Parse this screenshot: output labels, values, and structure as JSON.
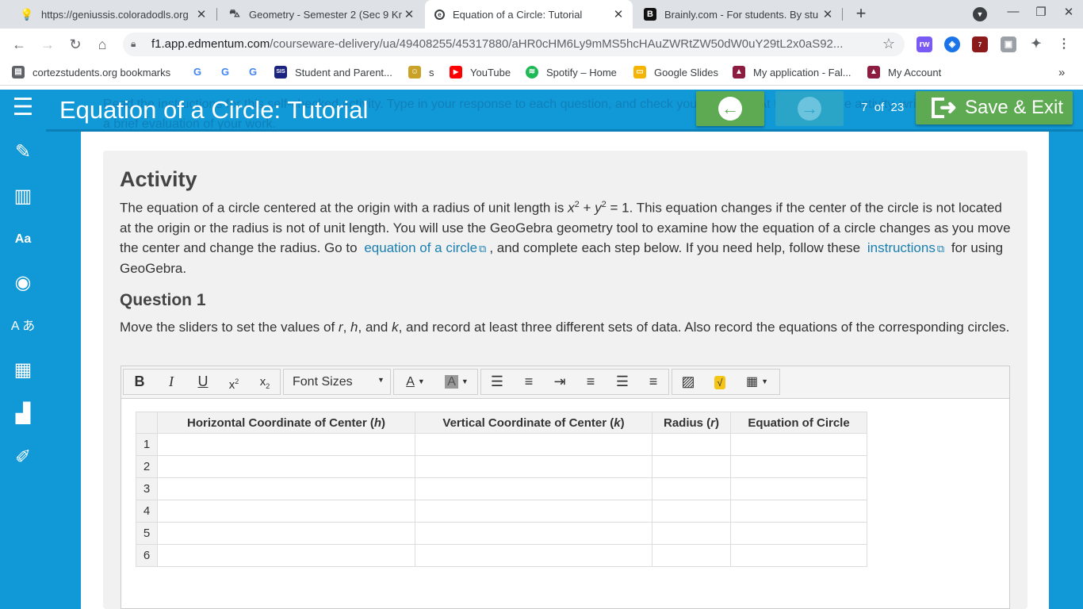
{
  "browser": {
    "tabs": [
      {
        "title": "https://geniussis.coloradodls.org",
        "icon": "lightbulb-icon"
      },
      {
        "title": "Geometry - Semester 2 (Sec 9 Kr",
        "icon": "car-icon"
      },
      {
        "title": "Equation of a Circle: Tutorial",
        "icon": "edmentum-icon"
      },
      {
        "title": "Brainly.com - For students. By stu",
        "icon": "brainly-icon"
      }
    ],
    "url_host": "f1.app.edmentum.com",
    "url_path": "/courseware-delivery/ua/49408255/45317880/aHR0cHM6Ly9mMS5hcHAuZWRtZW50dW0uY29tL2x0aS92...",
    "extension_badge": "7",
    "bookmarks": [
      {
        "label": "cortezstudents.org bookmarks",
        "icon": "folder-icon"
      },
      {
        "label": "",
        "icon": "google-icon"
      },
      {
        "label": "",
        "icon": "google-icon"
      },
      {
        "label": "",
        "icon": "google-icon"
      },
      {
        "label": "Student and Parent...",
        "icon": "sis-icon"
      },
      {
        "label": "s",
        "icon": "contact-icon"
      },
      {
        "label": "YouTube",
        "icon": "youtube-icon"
      },
      {
        "label": "Spotify – Home",
        "icon": "spotify-icon"
      },
      {
        "label": "Google Slides",
        "icon": "slides-icon"
      },
      {
        "label": "My application - Fal...",
        "icon": "university-icon"
      },
      {
        "label": "My Account",
        "icon": "university-icon"
      }
    ],
    "overflow_label": "»"
  },
  "app": {
    "header": {
      "title": "Equation of a Circle: Tutorial",
      "hidden_text": "Read the instructions for this self-checked activity. Type in your response to each question, and check your answers. At the end of the activity, write a brief evaluation of your work.",
      "page_current": "7",
      "page_of": "of",
      "page_total": "23",
      "save_label": "Save & Exit"
    },
    "sidebar_icons": [
      "menu-icon",
      "edit-icon",
      "library-icon",
      "dictionary-icon",
      "speech-icon",
      "translate-icon",
      "calculator-icon",
      "progress-icon",
      "highlighter-icon"
    ],
    "activity": {
      "heading": "Activity",
      "p1": "The equation of a circle centered at the origin with a radius of unit length is ",
      "eq_x": "x",
      "eq_2a": "2",
      "eq_plus": " + ",
      "eq_y": "y",
      "eq_2b": "2",
      "eq_rest": " = 1. This equation changes if the center of the circle is not located at the origin or the radius is not of unit length. You will use the GeoGebra geometry tool to examine how the equation of a circle changes as you move the center and change the radius. Go to ",
      "link1": "equation of a circle",
      "p2": ", and complete each step below. If you need help, follow these ",
      "link2": "instructions",
      "p3": " for using GeoGebra."
    },
    "question1": {
      "heading": "Question 1",
      "t1": "Move the sliders to set the values of ",
      "r": "r",
      "sep1": ", ",
      "h": "h",
      "sep2": ", and ",
      "k": "k",
      "t2": ", and record at least three different sets of data. Also record the equations of the corresponding circles."
    },
    "editor": {
      "font_sizes_label": "Font Sizes",
      "toolbar_icons": [
        "bold-icon",
        "italic-icon",
        "underline-icon",
        "superscript-icon",
        "subscript-icon",
        "font-color-icon",
        "background-color-icon",
        "bullet-list-icon",
        "numbered-list-icon",
        "indent-icon",
        "align-left-icon",
        "align-center-icon",
        "align-right-icon",
        "image-icon",
        "equation-icon",
        "table-icon"
      ]
    },
    "table": {
      "headers": {
        "h_pre": "Horizontal Coordinate of Center (",
        "h_var": "h",
        "h_post": ")",
        "k_pre": "Vertical Coordinate of Center (",
        "k_var": "k",
        "k_post": ")",
        "r_pre": "Radius (",
        "r_var": "r",
        "r_post": ")",
        "eq": "Equation of Circle"
      },
      "rows": [
        "1",
        "2",
        "3",
        "4",
        "5",
        "6"
      ]
    }
  },
  "colors": {
    "app_blue": "#1198d6",
    "button_green": "#5eaa52",
    "link_blue": "#1a7fb0"
  }
}
